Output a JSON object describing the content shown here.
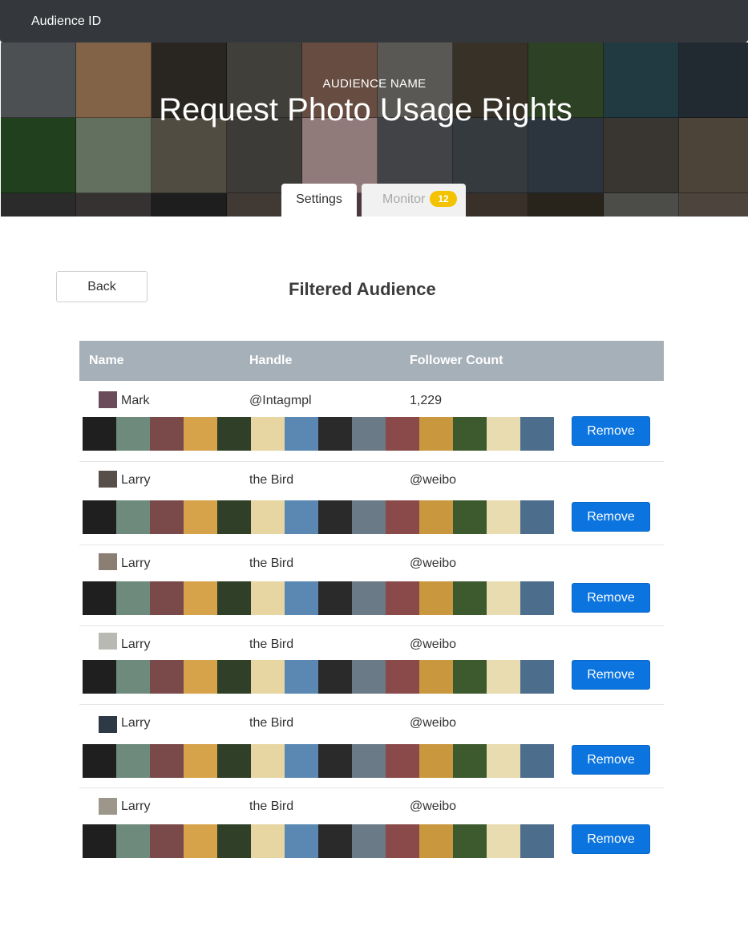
{
  "navbar": {
    "brand": "Audience ID"
  },
  "hero": {
    "label": "AUDIENCE NAME",
    "title": "Request Photo Usage Rights",
    "tile_colors": [
      "#6a6f72",
      "#b58a64",
      "#3a342e",
      "#5b5851",
      "#8f6a5c",
      "#7d7b75",
      "#4e4437",
      "#3f5a33",
      "#2f4f5a",
      "#2e3a44",
      "#2f5a2a",
      "#8a9a84",
      "#6f6a5c",
      "#55524e",
      "#c9a9a9",
      "#5a5e63",
      "#4a5158",
      "#3d4a57",
      "#4f4a44",
      "#6a5e50",
      "#3c3c3c",
      "#4a4644",
      "#2a2a2a",
      "#5a4f49",
      "#6b4e5a",
      "#50555a",
      "#4e4339",
      "#3a3226",
      "#6a6a66",
      "#6b5f57"
    ]
  },
  "tabs": {
    "settings": "Settings",
    "monitor": "Monitor",
    "monitor_badge": "12"
  },
  "toolbar": {
    "back_label": "Back"
  },
  "section": {
    "title": "Filtered Audience"
  },
  "table": {
    "columns": [
      "Name",
      "Handle",
      "Follower Count"
    ],
    "remove_label": "Remove",
    "strip_colors": [
      "#1f1f1f",
      "#6e8a7c",
      "#7a4a4a",
      "#d6a24a",
      "#2f3f28",
      "#e7d6a2",
      "#5a88b2",
      "#2a2a2a",
      "#6a7a86",
      "#8a4a4a",
      "#c9973e",
      "#3d5a2f",
      "#e9dcb0",
      "#4c6e8c"
    ],
    "rows": [
      {
        "avatar": "#6b4a5a",
        "name": "Mark",
        "handle": "@Intagmpl",
        "followers": "1,229"
      },
      {
        "avatar": "#57504a",
        "name": "Larry",
        "handle": "the Bird",
        "followers": "@weibo"
      },
      {
        "avatar": "#8a7f72",
        "name": "Larry",
        "handle": "the Bird",
        "followers": "@weibo"
      },
      {
        "avatar": "#b9b9b3",
        "name": "Larry",
        "handle": "the Bird",
        "followers": "@weibo"
      },
      {
        "avatar": "#2d3944",
        "name": "Larry",
        "handle": "the Bird",
        "followers": "@weibo"
      },
      {
        "avatar": "#9d968b",
        "name": "Larry",
        "handle": "the Bird",
        "followers": "@weibo"
      }
    ]
  }
}
